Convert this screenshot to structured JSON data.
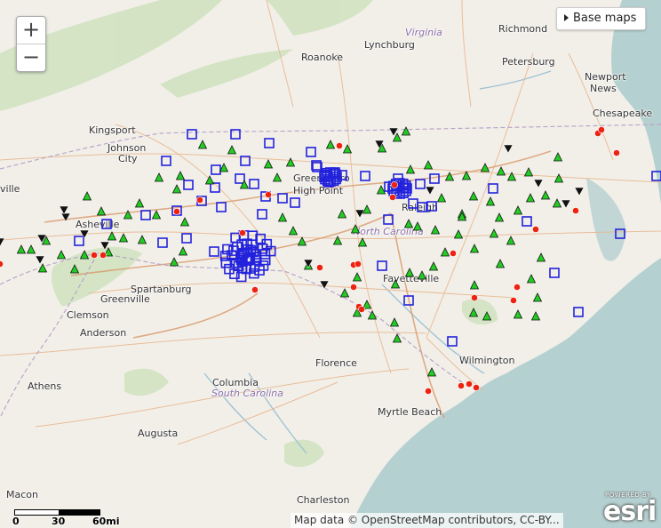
{
  "colors": {
    "land": "#f2efe9",
    "water": "#b5d0d0",
    "park": "#cfe2be",
    "road": "#e8b88f",
    "road_major": "#d99a6c",
    "border": "#b9a6c9",
    "square_marker": "#2222dd",
    "triangle_marker": "#22cc22",
    "circle_marker": "#ee2211",
    "down_triangle_marker": "#111111"
  },
  "controls": {
    "zoom_in": "+",
    "zoom_out": "−",
    "basemaps_label": "Base maps",
    "basemaps_icon": "triangle-right-icon"
  },
  "attribution": "Map data © OpenStreetMap contributors, CC-BY...",
  "scale": {
    "labels": [
      "0",
      "30",
      "60mi"
    ]
  },
  "logo": {
    "powered_by": "POWERED BY",
    "name": "esri"
  },
  "places": [
    {
      "name": "Lynchburg"
    },
    {
      "name": "Virginia"
    },
    {
      "name": "Richmond"
    },
    {
      "name": "Roanoke"
    },
    {
      "name": "Petersburg"
    },
    {
      "name": "Newport"
    },
    {
      "name": "News"
    },
    {
      "name": "Chesapeake"
    },
    {
      "name": "Kingsport"
    },
    {
      "name": "Johnson"
    },
    {
      "name": "City"
    },
    {
      "name": "Greensboro"
    },
    {
      "name": "High Point"
    },
    {
      "name": "Raleigh"
    },
    {
      "name": "North Carolina"
    },
    {
      "name": "ville"
    },
    {
      "name": "Asheville"
    },
    {
      "name": "Spartanburg"
    },
    {
      "name": "Greenville"
    },
    {
      "name": "Clemson"
    },
    {
      "name": "Anderson"
    },
    {
      "name": "Fayetteville"
    },
    {
      "name": "Wilmington"
    },
    {
      "name": "Florence"
    },
    {
      "name": "Athens"
    },
    {
      "name": "Columbia"
    },
    {
      "name": "South Carolina"
    },
    {
      "name": "Myrtle Beach"
    },
    {
      "name": "Augusta"
    },
    {
      "name": "Macon"
    },
    {
      "name": "Charleston"
    }
  ]
}
